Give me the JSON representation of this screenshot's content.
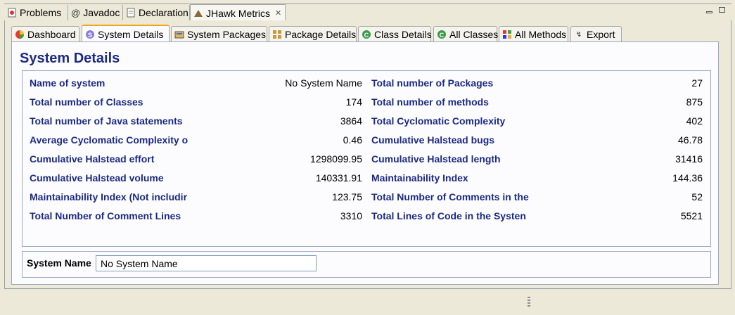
{
  "outer_tabs": [
    {
      "label": "Problems",
      "icon": "problems-icon"
    },
    {
      "label": "Javadoc",
      "icon": "javadoc-icon"
    },
    {
      "label": "Declaration",
      "icon": "declaration-icon"
    },
    {
      "label": "JHawk Metrics",
      "icon": "jhawk-icon",
      "active": true
    }
  ],
  "inner_tabs": [
    {
      "label": "Dashboard",
      "icon": "dashboard-icon"
    },
    {
      "label": "System Details",
      "icon": "system-icon",
      "active": true
    },
    {
      "label": "System Packages",
      "icon": "packages-icon"
    },
    {
      "label": "Package Details",
      "icon": "package-details-icon"
    },
    {
      "label": "Class Details",
      "icon": "class-icon"
    },
    {
      "label": "All Classes",
      "icon": "all-classes-icon"
    },
    {
      "label": "All Methods",
      "icon": "all-methods-icon"
    },
    {
      "label": "Export",
      "icon": "export-icon"
    }
  ],
  "panel": {
    "title": "System Details",
    "rows": [
      {
        "left_label": "Name of system",
        "left_value": "No System Name",
        "right_label": "Total number of Packages",
        "right_value": "27"
      },
      {
        "left_label": "Total number of Classes",
        "left_value": "174",
        "right_label": "Total number of methods",
        "right_value": "875"
      },
      {
        "left_label": "Total number of Java statements",
        "left_value": "3864",
        "right_label": "Total Cyclomatic Complexity",
        "right_value": "402"
      },
      {
        "left_label": "Average Cyclomatic Complexity o",
        "left_value": "0.46",
        "right_label": "Cumulative Halstead bugs",
        "right_value": "46.78"
      },
      {
        "left_label": "Cumulative Halstead effort",
        "left_value": "1298099.95",
        "right_label": "Cumulative Halstead length",
        "right_value": "31416"
      },
      {
        "left_label": "Cumulative Halstead volume",
        "left_value": "140331.91",
        "right_label": "Maintainability Index",
        "right_value": "144.36"
      },
      {
        "left_label": "Maintainability Index (Not includir",
        "left_value": "123.75",
        "right_label": "Total Number of Comments in the",
        "right_value": "52"
      },
      {
        "left_label": "Total Number of Comment Lines",
        "left_value": "3310",
        "right_label": "Total Lines of Code in the Systen",
        "right_value": "5521"
      }
    ],
    "system_name": {
      "label": "System Name",
      "value": "No System Name"
    }
  }
}
